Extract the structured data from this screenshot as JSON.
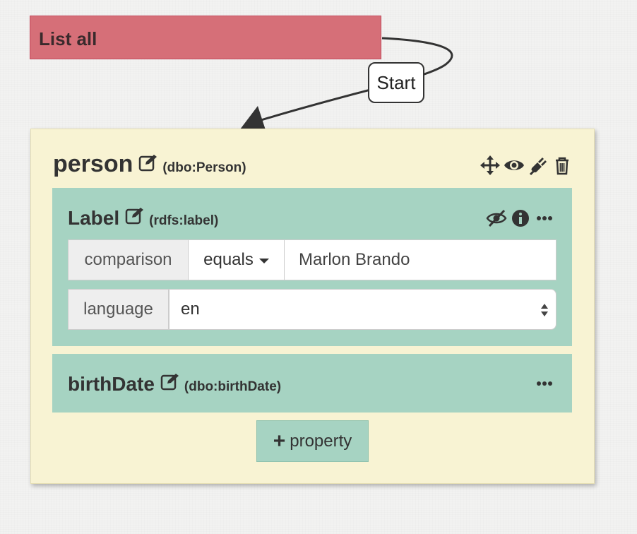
{
  "query": {
    "title": "List all",
    "edge_label": "Start"
  },
  "entity": {
    "name": "person",
    "uri": "(dbo:Person)",
    "tool_icons": [
      "move-icon",
      "eye-icon",
      "plug-icon",
      "trash-icon"
    ]
  },
  "properties": [
    {
      "name": "Label",
      "uri": "(rdfs:label)",
      "tool_icons": [
        "eye-slash-icon",
        "info-icon",
        "ellipsis-icon"
      ],
      "filter": {
        "comparison_label": "comparison",
        "operator": "equals",
        "value": "Marlon Brando",
        "language_label": "language",
        "language": "en"
      }
    },
    {
      "name": "birthDate",
      "uri": "(dbo:birthDate)",
      "tool_icons": [
        "ellipsis-icon"
      ]
    }
  ],
  "add_property": {
    "label": "property",
    "icon": "plus-icon"
  },
  "colors": {
    "query_node": "#d66f78",
    "entity_bg": "#f8f3d3",
    "property_bg": "#a6d3c2"
  }
}
